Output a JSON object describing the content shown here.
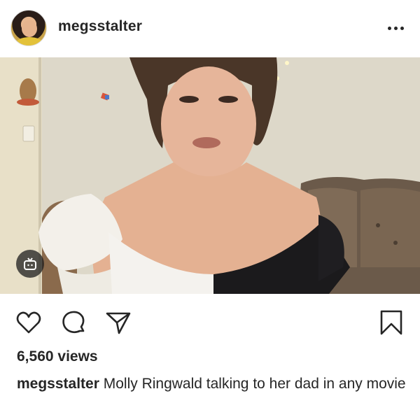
{
  "post": {
    "username": "megsstalter",
    "views": "6,560 views",
    "caption_user": "megsstalter",
    "caption_text": " Molly Ringwald talking to her dad in any movie"
  },
  "icons": {
    "more": "more-options-icon",
    "video": "igtv-video-icon",
    "like": "heart-icon",
    "comment": "comment-icon",
    "share": "share-icon",
    "save": "bookmark-icon"
  },
  "colors": {
    "text": "#262626",
    "background": "#ffffff"
  }
}
